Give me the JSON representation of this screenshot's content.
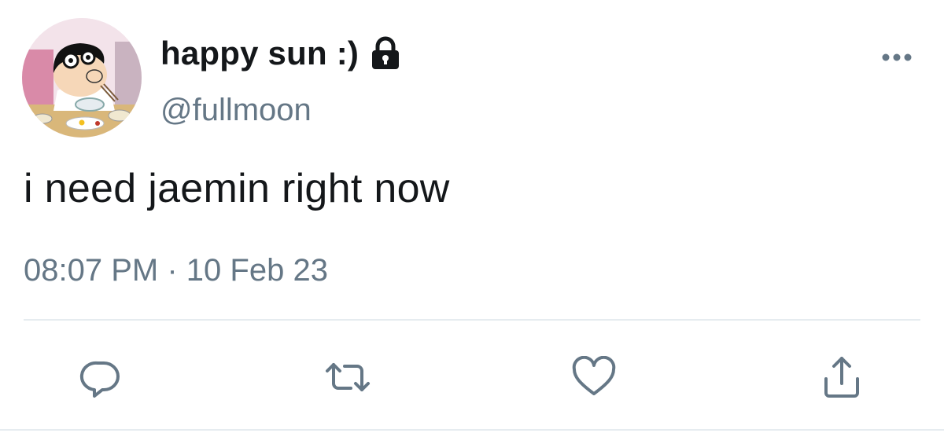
{
  "user": {
    "display_name": "happy sun :)",
    "handle": "@fullmoon",
    "protected": true,
    "avatar": "cartoon-boy-eating-avatar"
  },
  "tweet": {
    "text": "i need jaemin right now",
    "time": "08:07 PM",
    "separator": "·",
    "date": "10 Feb 23"
  },
  "actions": [
    {
      "name": "reply",
      "icon": "reply-icon"
    },
    {
      "name": "retweet",
      "icon": "retweet-icon"
    },
    {
      "name": "like",
      "icon": "heart-icon"
    },
    {
      "name": "share",
      "icon": "share-icon"
    }
  ],
  "colors": {
    "text_primary": "#14171a",
    "text_secondary": "#657786",
    "icon": "#657786",
    "divider": "#e6ecf0"
  }
}
